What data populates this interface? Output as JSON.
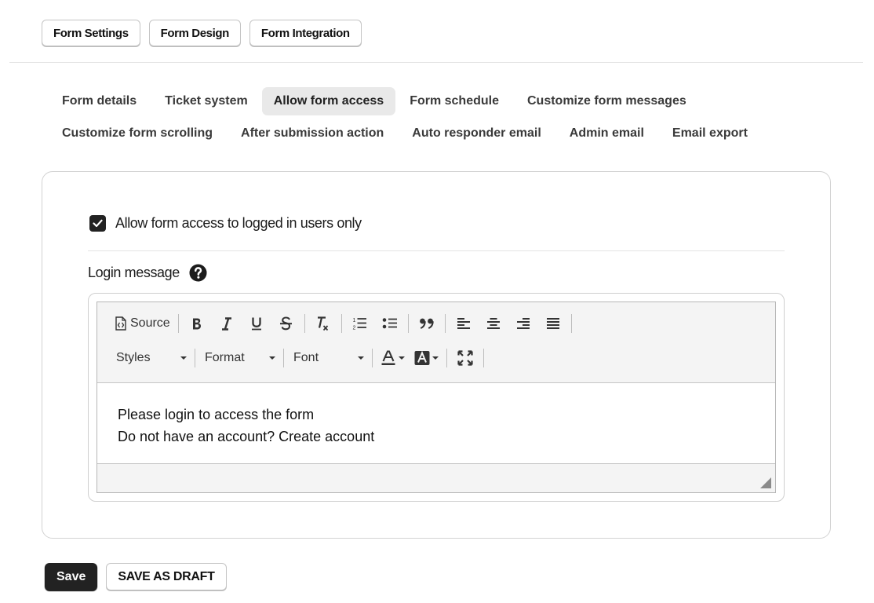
{
  "top_tabs": [
    "Form Settings",
    "Form Design",
    "Form Integration"
  ],
  "settings_tabs": {
    "row1": [
      "Form details",
      "Ticket system",
      "Allow form access",
      "Form schedule",
      "Customize form messages"
    ],
    "row2": [
      "Customize form scrolling",
      "After submission action",
      "Auto responder email",
      "Admin email",
      "Email export"
    ],
    "active": "Allow form access"
  },
  "access": {
    "checkbox_label": "Allow form access to logged in users only",
    "checked": true,
    "login_message_label": "Login message"
  },
  "editor": {
    "toolbar": {
      "source_label": "Source",
      "styles_label": "Styles",
      "format_label": "Format",
      "font_label": "Font",
      "icons": [
        "source-icon",
        "bold-icon",
        "italic-icon",
        "underline-icon",
        "strikethrough-icon",
        "remove-format-icon",
        "numbered-list-icon",
        "bulleted-list-icon",
        "blockquote-icon",
        "align-left-icon",
        "align-center-icon",
        "align-right-icon",
        "justify-icon",
        "text-color-icon",
        "background-color-icon",
        "maximize-icon"
      ]
    },
    "content_lines": [
      "Please login to access the form",
      "Do not have an account? Create account"
    ]
  },
  "actions": {
    "save_label": "Save",
    "draft_label": "SAVE AS DRAFT"
  },
  "colors": {
    "primary_button": "#222222",
    "active_tab_bg": "#e9e9e9",
    "toolbar_bg": "#f4f4f4"
  }
}
